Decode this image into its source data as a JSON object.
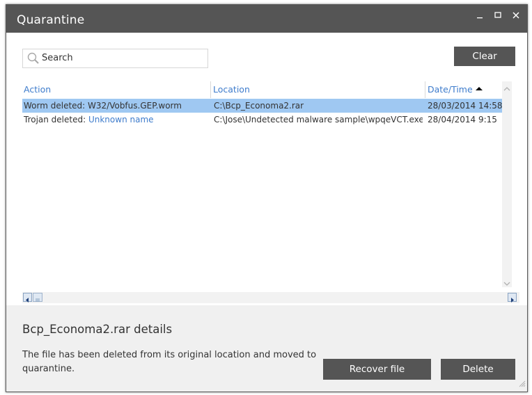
{
  "window": {
    "title": "Quarantine",
    "controls": {
      "minimize": "_",
      "maximize": "☐",
      "close": "✕"
    }
  },
  "search": {
    "placeholder": "Search",
    "value": ""
  },
  "toolbar": {
    "clear_label": "Clear"
  },
  "table": {
    "columns": [
      "Action",
      "Location",
      "Date/Time"
    ],
    "sort": {
      "column": "Date/Time",
      "direction": "ascending"
    },
    "rows": [
      {
        "action_prefix": "Worm deleted: ",
        "action_name": "W32/Vobfus.GEP.worm",
        "location": "C:\\Bcp_Economa2.rar",
        "datetime": "28/03/2014 14:58",
        "selected": true
      },
      {
        "action_prefix": "Trojan deleted: ",
        "action_name": "Unknown name",
        "location": "C:\\Jose\\Undetected malware sample\\wpqeVCT.exe",
        "datetime": "28/04/2014 9:15",
        "selected": false
      }
    ]
  },
  "details": {
    "title": "Bcp_Economa2.rar details",
    "description": "The file has been deleted from its original location and moved to quarantine.",
    "recover_label": "Recover file",
    "delete_label": "Delete"
  },
  "colors": {
    "titlebar": "#555555",
    "link": "#3e7ccc",
    "selection": "#9fc8f2",
    "button": "#555555",
    "details_bg": "#f0f0f0"
  },
  "icons": [
    "search-icon",
    "sort-ascending-icon",
    "scroll-up-icon",
    "scroll-down-icon",
    "scroll-left-icon",
    "scroll-right-icon",
    "resize-grip-icon"
  ]
}
